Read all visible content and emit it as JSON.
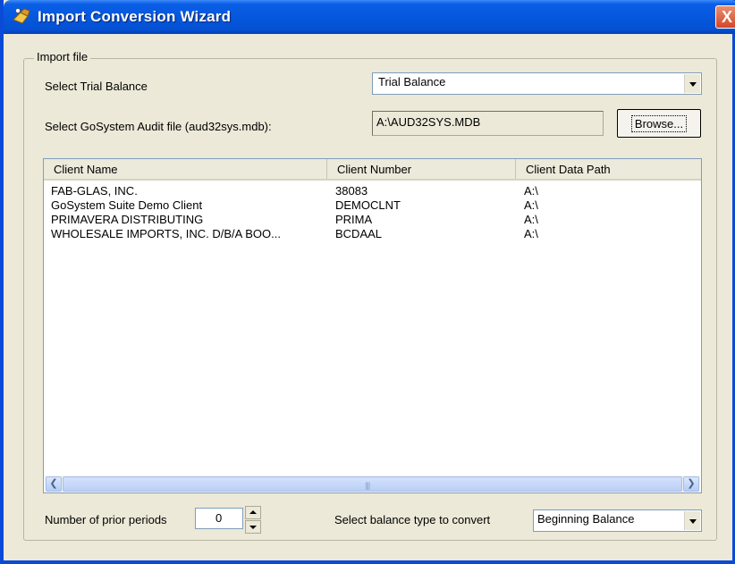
{
  "window": {
    "title": "Import Conversion Wizard",
    "close_label": "X"
  },
  "import_file": {
    "group_label": "Import file",
    "trial_balance_label": "Select Trial Balance",
    "trial_balance_value": "Trial Balance",
    "audit_file_label": "Select GoSystem Audit file (aud32sys.mdb):",
    "audit_file_value": "A:\\AUD32SYS.MDB",
    "browse_label": "Browse..."
  },
  "client_list": {
    "columns": [
      "Client Name",
      "Client Number",
      "Client Data Path"
    ],
    "rows": [
      [
        "FAB-GLAS, INC.",
        "38083",
        "A:\\"
      ],
      [
        "GoSystem Suite Demo Client",
        "DEMOCLNT",
        "A:\\"
      ],
      [
        "PRIMAVERA DISTRIBUTING",
        "PRIMA",
        "A:\\"
      ],
      [
        "WHOLESALE IMPORTS, INC. D/B/A BOO...",
        "BCDAAL",
        "A:\\"
      ]
    ]
  },
  "footer": {
    "prior_periods_label": "Number of prior periods",
    "prior_periods_value": "0",
    "balance_type_label": "Select balance type to convert",
    "balance_type_value": "Beginning Balance"
  }
}
